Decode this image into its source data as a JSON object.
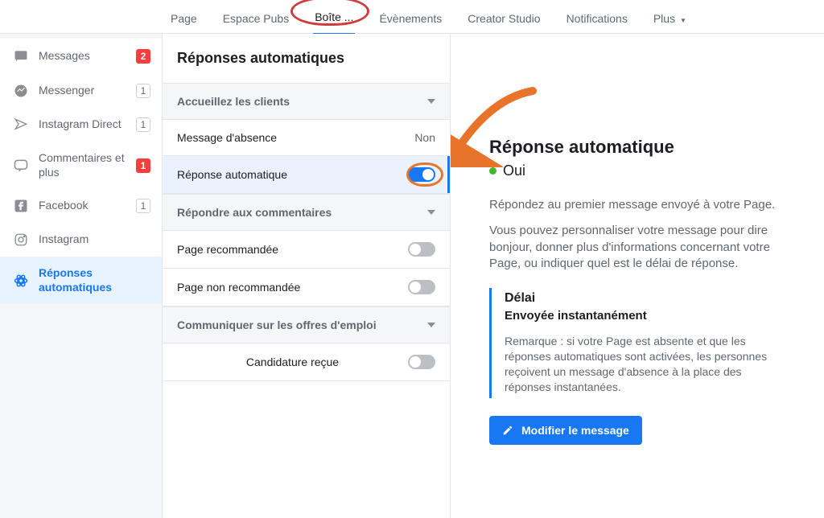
{
  "topnav": {
    "tabs": [
      {
        "label": "Page"
      },
      {
        "label": "Espace Pubs"
      },
      {
        "label": "Boîte ..."
      },
      {
        "label": "Évènements"
      },
      {
        "label": "Creator Studio"
      },
      {
        "label": "Notifications"
      },
      {
        "label": "Plus"
      }
    ],
    "active_index": 2
  },
  "sidebar": {
    "items": [
      {
        "icon": "chat-icon",
        "label": "Messages",
        "badge": "2",
        "badge_style": "red"
      },
      {
        "icon": "messenger-icon",
        "label": "Messenger",
        "badge": "1",
        "badge_style": "box"
      },
      {
        "icon": "instagram-dm-icon",
        "label": "Instagram Direct",
        "badge": "1",
        "badge_style": "box"
      },
      {
        "icon": "comment-icon",
        "label": "Commentaires et plus",
        "badge": "1",
        "badge_style": "red"
      },
      {
        "icon": "facebook-icon",
        "label": "Facebook",
        "badge": "1",
        "badge_style": "box"
      },
      {
        "icon": "instagram-icon",
        "label": "Instagram",
        "badge": null
      },
      {
        "icon": "auto-reply-icon",
        "label": "Réponses automatiques",
        "badge": null
      }
    ],
    "selected_index": 6
  },
  "middle": {
    "title": "Réponses automatiques",
    "groups": [
      {
        "header": "Accueillez les clients",
        "rows": [
          {
            "label": "Message d'absence",
            "kind": "value",
            "value": "Non"
          },
          {
            "label": "Réponse automatique",
            "kind": "toggle",
            "on": true,
            "highlight": true
          }
        ]
      },
      {
        "header": "Répondre aux commentaires",
        "rows": [
          {
            "label": "Page recommandée",
            "kind": "toggle",
            "on": false
          },
          {
            "label": "Page non recommandée",
            "kind": "toggle",
            "on": false
          }
        ]
      },
      {
        "header": "Communiquer sur les offres d'emploi",
        "rows": [
          {
            "label": "Candidature reçue",
            "kind": "toggle",
            "on": false
          }
        ]
      }
    ]
  },
  "detail": {
    "title": "Réponse automatique",
    "status_label": "Oui",
    "status_color": "#42b72a",
    "paragraph1": "Répondez au premier message envoyé à votre Page.",
    "paragraph2": "Vous pouvez personnaliser votre message pour dire bonjour, donner plus d'informations concernant votre Page, ou indiquer quel est le délai de réponse.",
    "infobox_title": "Délai",
    "infobox_subtitle": "Envoyée instantanément",
    "infobox_note": "Remarque : si votre Page est absente et que les réponses automatiques sont activées, les personnes reçoivent un message d'absence à la place des réponses instantanées.",
    "button_label": "Modifier le message"
  },
  "annotation": {
    "tab_circled": 2,
    "toggle_circled": true,
    "arrow_points_to": "auto-reply-toggle"
  },
  "colors": {
    "brand_blue": "#1877f2",
    "danger_red": "#fa3e3e",
    "annotation_orange": "#e8742c",
    "annotation_red": "#d13b3b"
  }
}
